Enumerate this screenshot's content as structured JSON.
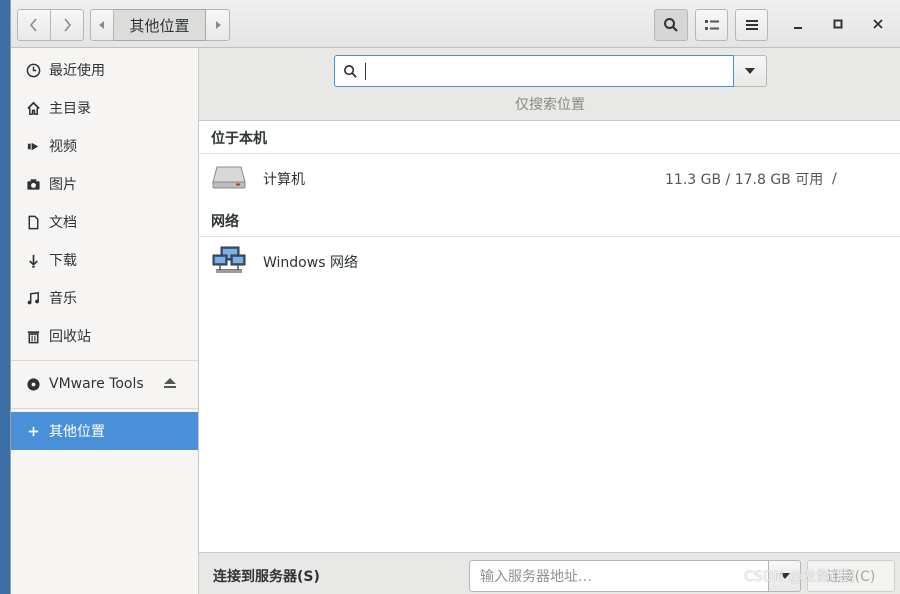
{
  "header": {
    "breadcrumb": "其他位置"
  },
  "sidebar": {
    "items": [
      {
        "label": "最近使用",
        "icon": "clock-icon"
      },
      {
        "label": "主目录",
        "icon": "home-icon"
      },
      {
        "label": "视频",
        "icon": "video-icon"
      },
      {
        "label": "图片",
        "icon": "camera-icon"
      },
      {
        "label": "文档",
        "icon": "document-icon"
      },
      {
        "label": "下载",
        "icon": "download-icon"
      },
      {
        "label": "音乐",
        "icon": "music-icon"
      },
      {
        "label": "回收站",
        "icon": "trash-icon"
      }
    ],
    "device": {
      "label": "VMware Tools",
      "icon": "disc-icon"
    },
    "other": {
      "label": "其他位置",
      "icon": "plus-icon",
      "selected": true
    }
  },
  "search": {
    "value": "",
    "hint": "仅搜索位置"
  },
  "sections": {
    "local_title": "位于本机",
    "network_title": "网络"
  },
  "locations": {
    "computer": {
      "name": "计算机",
      "space": "11.3 GB / 17.8 GB 可用",
      "mount": "/"
    },
    "windows": {
      "name": "Windows 网络"
    }
  },
  "footer": {
    "label": "连接到服务器(S)",
    "placeholder": "输入服务器地址…",
    "connect_label": "连接(C)"
  },
  "watermark": "CSDN @龙数(辰)",
  "colors": {
    "accent": "#4a90d9",
    "desktop": "#3b6ea5"
  }
}
